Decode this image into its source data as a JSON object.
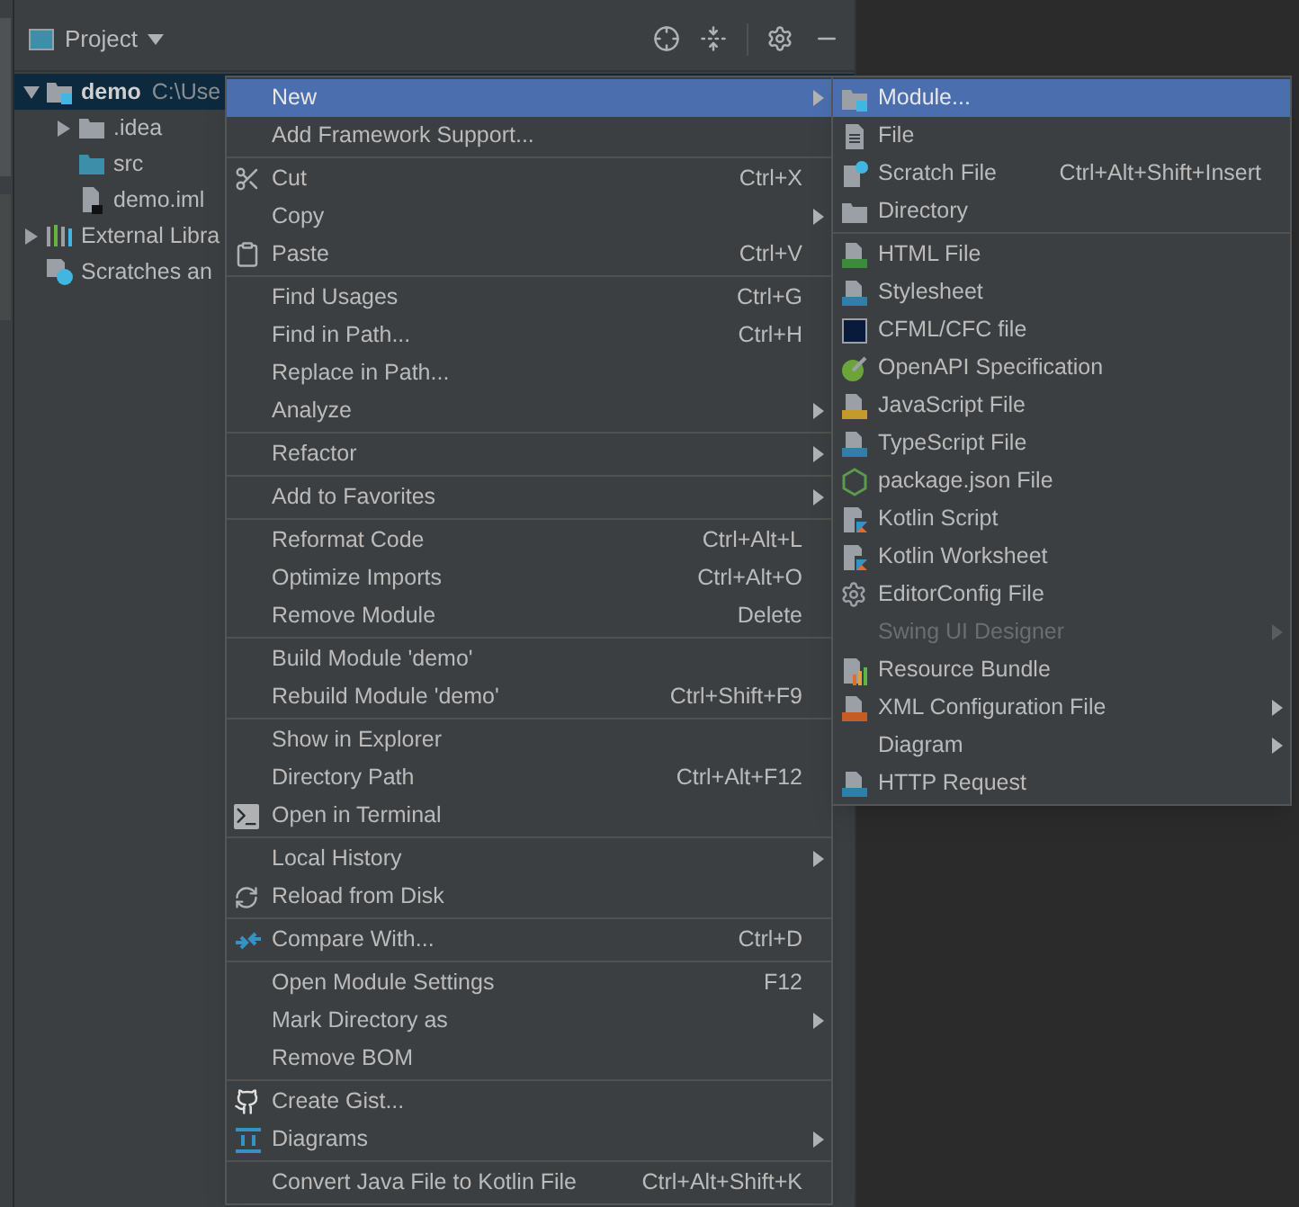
{
  "panel": {
    "title": "Project"
  },
  "tree": [
    {
      "label": "demo",
      "path": "C:\\Use",
      "kind": "module",
      "expanded": true,
      "selected": true,
      "children": [
        {
          "label": ".idea",
          "kind": "folder",
          "expanded": false,
          "selected": false
        },
        {
          "label": "src",
          "kind": "source-folder",
          "selected": false
        },
        {
          "label": "demo.iml",
          "kind": "iml",
          "selected": false
        }
      ]
    },
    {
      "label": "External Libra",
      "kind": "libraries",
      "expanded": false,
      "selected": false
    },
    {
      "label": "Scratches an",
      "kind": "scratches",
      "selected": false
    }
  ],
  "context_menu": {
    "groups": [
      [
        {
          "label": "New",
          "submenu": true,
          "selected": true
        },
        {
          "label": "Add Framework Support...",
          "selected": false
        }
      ],
      [
        {
          "label": "Cut",
          "shortcut": "Ctrl+X",
          "kind": "cut",
          "selected": false
        },
        {
          "label": "Copy",
          "submenu": true,
          "selected": false
        },
        {
          "label": "Paste",
          "shortcut": "Ctrl+V",
          "kind": "paste",
          "selected": false
        }
      ],
      [
        {
          "label": "Find Usages",
          "shortcut": "Ctrl+G",
          "selected": false
        },
        {
          "label": "Find in Path...",
          "shortcut": "Ctrl+H",
          "selected": false
        },
        {
          "label": "Replace in Path...",
          "selected": false
        },
        {
          "label": "Analyze",
          "submenu": true,
          "selected": false
        }
      ],
      [
        {
          "label": "Refactor",
          "submenu": true,
          "selected": false
        }
      ],
      [
        {
          "label": "Add to Favorites",
          "submenu": true,
          "selected": false
        }
      ],
      [
        {
          "label": "Reformat Code",
          "shortcut": "Ctrl+Alt+L",
          "selected": false
        },
        {
          "label": "Optimize Imports",
          "shortcut": "Ctrl+Alt+O",
          "selected": false
        },
        {
          "label": "Remove Module",
          "shortcut": "Delete",
          "selected": false
        }
      ],
      [
        {
          "label": "Build Module 'demo'",
          "selected": false
        },
        {
          "label": "Rebuild Module 'demo'",
          "shortcut": "Ctrl+Shift+F9",
          "selected": false
        }
      ],
      [
        {
          "label": "Show in Explorer",
          "selected": false
        },
        {
          "label": "Directory Path",
          "shortcut": "Ctrl+Alt+F12",
          "selected": false
        },
        {
          "label": "Open in Terminal",
          "kind": "terminal",
          "selected": false
        }
      ],
      [
        {
          "label": "Local History",
          "submenu": true,
          "selected": false
        },
        {
          "label": "Reload from Disk",
          "kind": "reload",
          "selected": false
        }
      ],
      [
        {
          "label": "Compare With...",
          "shortcut": "Ctrl+D",
          "kind": "compare",
          "selected": false
        }
      ],
      [
        {
          "label": "Open Module Settings",
          "shortcut": "F12",
          "selected": false
        },
        {
          "label": "Mark Directory as",
          "submenu": true,
          "selected": false
        },
        {
          "label": "Remove BOM",
          "selected": false
        }
      ],
      [
        {
          "label": "Create Gist...",
          "kind": "github",
          "selected": false
        },
        {
          "label": "Diagrams",
          "submenu": true,
          "kind": "diagrams",
          "selected": false
        }
      ],
      [
        {
          "label": "Convert Java File to Kotlin File",
          "shortcut": "Ctrl+Alt+Shift+K",
          "selected": false
        }
      ]
    ]
  },
  "new_submenu": {
    "groups": [
      [
        {
          "label": "Module...",
          "kind": "module",
          "selected": true,
          "disabled": false
        },
        {
          "label": "File",
          "kind": "file",
          "selected": false,
          "disabled": false
        },
        {
          "label": "Scratch File",
          "shortcut": "Ctrl+Alt+Shift+Insert",
          "kind": "scratch",
          "selected": false,
          "disabled": false
        },
        {
          "label": "Directory",
          "kind": "folder",
          "selected": false,
          "disabled": false
        }
      ],
      [
        {
          "label": "HTML File",
          "kind": "html",
          "selected": false,
          "disabled": false
        },
        {
          "label": "Stylesheet",
          "kind": "css",
          "selected": false,
          "disabled": false
        },
        {
          "label": "CFML/CFC file",
          "kind": "cfml",
          "selected": false,
          "disabled": false
        },
        {
          "label": "OpenAPI Specification",
          "kind": "openapi",
          "selected": false,
          "disabled": false
        },
        {
          "label": "JavaScript File",
          "kind": "js",
          "selected": false,
          "disabled": false
        },
        {
          "label": "TypeScript File",
          "kind": "ts",
          "selected": false,
          "disabled": false
        },
        {
          "label": "package.json File",
          "kind": "nodejs",
          "selected": false,
          "disabled": false
        },
        {
          "label": "Kotlin Script",
          "kind": "kotlin",
          "selected": false,
          "disabled": false
        },
        {
          "label": "Kotlin Worksheet",
          "kind": "kotlin",
          "selected": false,
          "disabled": false
        },
        {
          "label": "EditorConfig File",
          "kind": "gear",
          "selected": false,
          "disabled": false
        },
        {
          "label": "Swing UI Designer",
          "submenu": true,
          "selected": false,
          "disabled": true
        },
        {
          "label": "Resource Bundle",
          "kind": "bundle",
          "selected": false,
          "disabled": false
        },
        {
          "label": "XML Configuration File",
          "submenu": true,
          "kind": "xml",
          "selected": false,
          "disabled": false
        },
        {
          "label": "Diagram",
          "submenu": true,
          "selected": false,
          "disabled": false
        },
        {
          "label": "HTTP Request",
          "kind": "api",
          "selected": false,
          "disabled": false
        }
      ]
    ]
  }
}
